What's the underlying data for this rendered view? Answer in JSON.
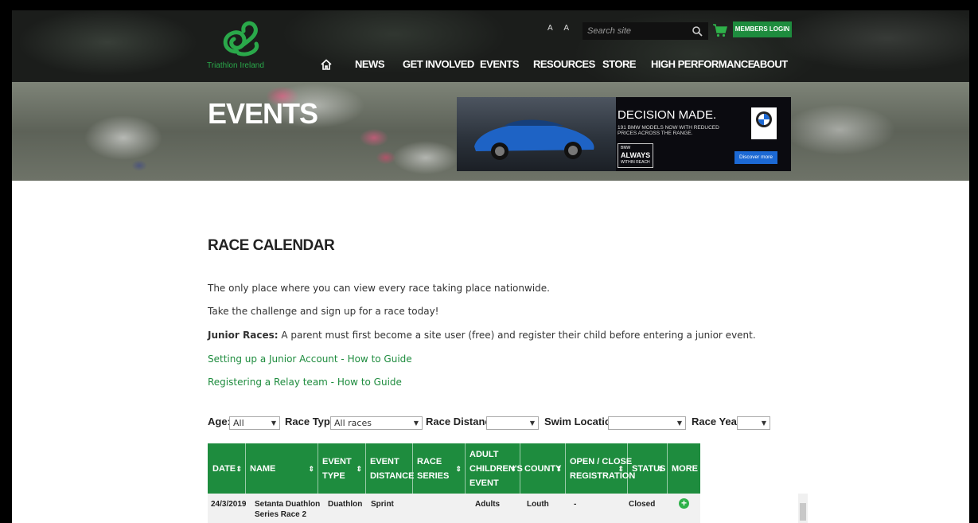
{
  "header": {
    "logo_text": "Triathlon Ireland",
    "font_size_toggle": "A A",
    "search_placeholder": "Search site",
    "members_login": "MEMBERS LOGIN",
    "nav": [
      "NEWS",
      "GET INVOLVED",
      "EVENTS",
      "RESOURCES",
      "STORE",
      "HIGH PERFORMANCE",
      "ABOUT"
    ]
  },
  "hero": {
    "title": "EVENTS",
    "ad": {
      "headline": "DECISION MADE.",
      "subline": "191 BMW MODELS NOW WITH REDUCED PRICES ACROSS THE RANGE.",
      "tag_small": "BMW",
      "tag": "ALWAYS",
      "tag_sub": "WITHIN REACH",
      "button": "Discover more"
    }
  },
  "content": {
    "title": "RACE CALENDAR",
    "intro1": "The only place where you can view every race taking place nationwide.",
    "intro2": "Take the challenge and sign up for a race today!",
    "junior_label": "Junior Races:",
    "junior_text": " A parent must first become a site user (free) and register their child before entering a junior event.",
    "link1": "Setting up a Junior Account - How to Guide",
    "link2": "Registering a Relay team - How to Guide"
  },
  "filters": {
    "age_label": "Age:",
    "age_value": "All",
    "race_type_label": "Race Type:",
    "race_type_value": "All races",
    "race_distance_label": "Race Distance:",
    "race_distance_value": "",
    "swim_location_label": "Swim Location:",
    "swim_location_value": "",
    "race_year_label": "Race Year:",
    "race_year_value": ""
  },
  "table": {
    "headers": {
      "date": "DATE",
      "name": "NAME",
      "event_type_1": "EVENT",
      "event_type_2": "TYPE",
      "event_distance_1": "EVENT",
      "event_distance_2": "DISTANCE",
      "race_series_1": "RACE",
      "race_series_2": "SERIES",
      "adult_1": "ADULT",
      "adult_2": "CHILDREN'S",
      "adult_3": "EVENT",
      "county": "COUNTY",
      "reg_1": "OPEN / CLOSE",
      "reg_2": "REGISTRATION",
      "status": "STATUS",
      "more": "MORE"
    },
    "rows": [
      {
        "date": "24/3/2019",
        "name_1": "Setanta Duathlon",
        "name_2": "Series Race 2",
        "event_type": "Duathlon",
        "event_distance": "Sprint",
        "race_series": "",
        "adult_children": "Adults",
        "county": "Louth",
        "registration": "-",
        "status": "Closed",
        "more": "+"
      }
    ]
  }
}
